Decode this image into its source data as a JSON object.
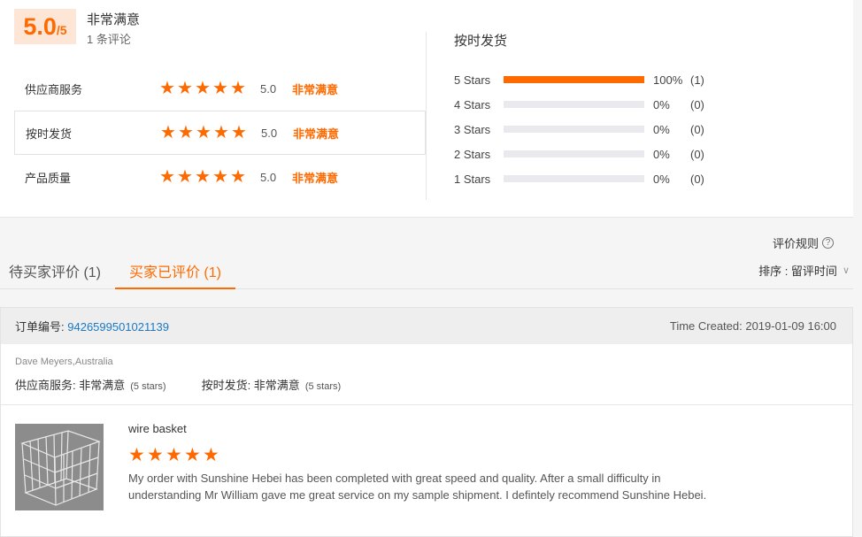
{
  "summary": {
    "score": "5.0",
    "score_max": "/5",
    "level": "非常满意",
    "count": "1 条评论"
  },
  "dimensions": [
    {
      "label": "供应商服务",
      "score": "5.0",
      "level": "非常满意",
      "stars": 5
    },
    {
      "label": "按时发货",
      "score": "5.0",
      "level": "非常满意",
      "stars": 5
    },
    {
      "label": "产品质量",
      "score": "5.0",
      "level": "非常满意",
      "stars": 5
    }
  ],
  "distribution": {
    "title": "按时发货",
    "rows": [
      {
        "label": "5  Stars",
        "percent": "100%",
        "count": "(1)",
        "fill": 1.0
      },
      {
        "label": "4  Stars",
        "percent": "0%",
        "count": "(0)",
        "fill": 0
      },
      {
        "label": "3  Stars",
        "percent": "0%",
        "count": "(0)",
        "fill": 0
      },
      {
        "label": "2  Stars",
        "percent": "0%",
        "count": "(0)",
        "fill": 0
      },
      {
        "label": "1  Stars",
        "percent": "0%",
        "count": "(0)",
        "fill": 0
      }
    ]
  },
  "rules_link": "评价规则",
  "tabs": [
    {
      "label": "待买家评价 (1)"
    },
    {
      "label": "买家已评价 (1)"
    }
  ],
  "sort": {
    "label": "排序 : 留评时间"
  },
  "review": {
    "order_label": "订单编号:",
    "order_no": "9426599501021139",
    "time_created": "Time Created: 2019-01-09 16:00",
    "buyer": "Dave Meyers,Australia",
    "supplier_service": "供应商服务: 非常满意",
    "supplier_service_note": "(5 stars)",
    "on_time": "按时发货: 非常满意",
    "on_time_note": "(5 stars)",
    "product_name": "wire basket",
    "rating": 5,
    "text": "My order with Sunshine Hebei has been completed with great speed and quality. After a small difficulty in understanding Mr William gave me great service on my sample shipment. I defintely recommend Sunshine Hebei."
  },
  "colors": {
    "accent": "#ff6a00",
    "link": "#1a7ac7",
    "score_bg": "#fde6d6"
  }
}
